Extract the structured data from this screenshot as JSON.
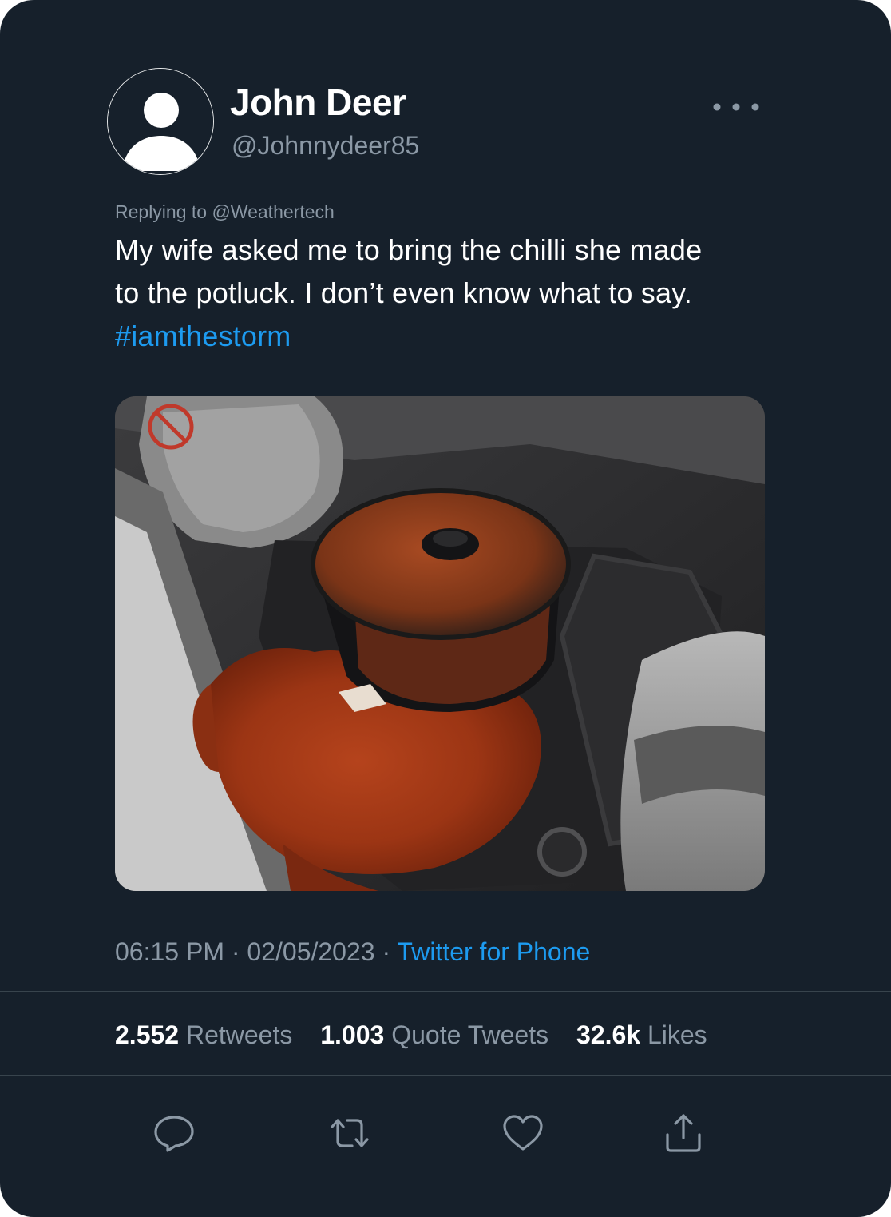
{
  "tweet": {
    "display_name": "John Deer",
    "handle": "@Johnnydeer85",
    "reply_context": "Replying to @Weathertech",
    "text_lines": [
      "My wife asked me to bring the chilli she made",
      "to the potluck. I don’t even know what to say."
    ],
    "hashtag": "#iamthestorm",
    "time": "06:15 PM",
    "date": "02/05/2023",
    "separator": "·",
    "source": "Twitter for Phone",
    "media_description": "Crock pot spilled chilli on car floor"
  },
  "stats": {
    "retweets_count": "2.552",
    "retweets_label": "Retweets",
    "quotes_count": "1.003",
    "quotes_label": "Quote Tweets",
    "likes_count": "32.6k",
    "likes_label": "Likes"
  },
  "actions": {
    "reply_icon": "comment-bubble-icon",
    "retweet_icon": "retweet-arrows-icon",
    "like_icon": "heart-icon",
    "share_icon": "share-upload-icon"
  },
  "colors": {
    "background": "#16202b",
    "primary_text": "#ffffff",
    "secondary_text": "#8b98a5",
    "accent": "#1d9bf0",
    "divider": "#38444d"
  }
}
